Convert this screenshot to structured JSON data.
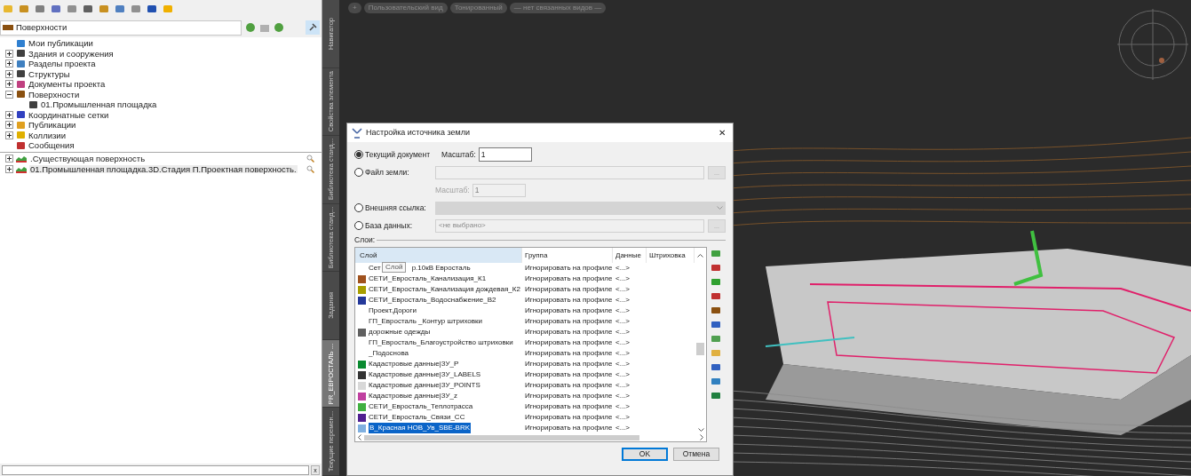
{
  "navigator": {
    "location": {
      "value": "Поверхности"
    },
    "tree": [
      {
        "label": "Мои публикации",
        "expandable": false
      },
      {
        "label": "Здания и сооружения",
        "expandable": true,
        "expanded": false
      },
      {
        "label": "Разделы проекта",
        "expandable": true,
        "expanded": false
      },
      {
        "label": "Структуры",
        "expandable": true,
        "expanded": false
      },
      {
        "label": "Документы проекта",
        "expandable": true,
        "expanded": false
      },
      {
        "label": "Поверхности",
        "expandable": true,
        "expanded": true,
        "children": [
          {
            "label": "01.Промышленная площадка",
            "expandable": false
          }
        ]
      },
      {
        "label": "Координатные сетки",
        "expandable": true,
        "expanded": false
      },
      {
        "label": "Публикации",
        "expandable": true,
        "expanded": false
      },
      {
        "label": "Коллизии",
        "expandable": true,
        "expanded": false
      },
      {
        "label": "Сообщения",
        "expandable": false
      }
    ],
    "surfaces": [
      {
        "label": ".Существующая поверхность",
        "selected": false
      },
      {
        "label": "01.Промышленная площадка.3D.Стадия П.Проектная поверхность.",
        "selected": true
      }
    ],
    "filter": {
      "clear": "x"
    }
  },
  "side_tabs": [
    {
      "label": "Навигатор",
      "selected": false
    },
    {
      "label": "Свойства элемента",
      "selected": false
    },
    {
      "label": "Библиотека станд...",
      "selected": false
    },
    {
      "label": "Библиотека станд...",
      "selected": false
    },
    {
      "label": "Задания",
      "selected": false
    },
    {
      "label": "PR_ЕВРОСТАЛЬ ...",
      "selected": true
    },
    {
      "label": "Текущие перемен...",
      "selected": false
    }
  ],
  "viewport": {
    "chips": [
      "+",
      "Пользовательский вид",
      "Тонированный",
      "— нет связанных видов —"
    ]
  },
  "dialog": {
    "title": "Настройка источника земли",
    "close": "✕",
    "sources": [
      {
        "kind": "scale",
        "label": "Текущий документ",
        "selected": true,
        "scale_label": "Масштаб:",
        "scale": "1"
      },
      {
        "kind": "file",
        "label": "Файл земли:",
        "selected": false,
        "browse": "...",
        "scale_label": "Масштаб:",
        "scale": "1"
      },
      {
        "kind": "dropdown",
        "label": "Внешняя ссылка:",
        "selected": false
      },
      {
        "kind": "database",
        "label": "База данных:",
        "selected": false,
        "value": "<не выбрано>",
        "browse": "..."
      }
    ],
    "layers_label": "Слои:",
    "columns": [
      "Слой",
      "Группа",
      "Данные",
      "Штриховка"
    ],
    "tooltip": "Слой",
    "rows": [
      {
        "layer": "Сет",
        "layer_tail": "р.10кВ Евросталь",
        "group": "Игнорировать на профиле",
        "data": "<...>",
        "selected": false
      },
      {
        "color": "#a0521e",
        "layer": "СЕТИ_Евросталь_Канализация_К1",
        "group": "Игнорировать на профиле",
        "data": "<...>",
        "selected": false
      },
      {
        "color": "#a89e00",
        "layer": "СЕТИ_Евросталь_Канализация дождевая_К2",
        "group": "Игнорировать на профиле",
        "data": "<...>",
        "selected": false
      },
      {
        "color": "#24389a",
        "layer": "СЕТИ_Евросталь_Водоснабжение_В2",
        "group": "Игнорировать на профиле",
        "data": "<...>",
        "selected": false
      },
      {
        "layer": "Проект.Дороги",
        "group": "Игнорировать на профиле",
        "data": "<...>",
        "selected": false
      },
      {
        "layer": "ГП_Евросталь _Контур штриховки",
        "group": "Игнорировать на профиле",
        "data": "<...>",
        "selected": false
      },
      {
        "color": "#606060",
        "layer": "дорожные одежды",
        "group": "Игнорировать на профиле",
        "data": "<...>",
        "selected": false
      },
      {
        "layer": "ГП_Евросталь_Благоустройство штриховки",
        "group": "Игнорировать на профиле",
        "data": "<...>",
        "selected": false
      },
      {
        "layer": "_Подоснова",
        "group": "Игнорировать на профиле",
        "data": "<...>",
        "selected": false
      },
      {
        "color": "#0a8a30",
        "layer": "Кадастровые данные|ЗУ_Р",
        "group": "Игнорировать на профиле",
        "data": "<...>",
        "selected": false
      },
      {
        "color": "#333333",
        "layer": "Кадастровые данные|ЗУ_LABELS",
        "group": "Игнорировать на профиле",
        "data": "<...>",
        "selected": false
      },
      {
        "color": "#d8d8d8",
        "layer": "Кадастровые данные|ЗУ_POINTS",
        "group": "Игнорировать на профиле",
        "data": "<...>",
        "selected": false
      },
      {
        "color": "#c040a0",
        "layer": "Кадастровые данные|ЗУ_z",
        "group": "Игнорировать на профиле",
        "data": "<...>",
        "selected": false
      },
      {
        "color": "#40b040",
        "layer": "СЕТИ_Евросталь_Теплотрасса",
        "group": "Игнорировать на профиле",
        "data": "<...>",
        "selected": false
      },
      {
        "color": "#502090",
        "layer": "СЕТИ_Евросталь_Связи_СС",
        "group": "Игнорировать на профиле",
        "data": "<...>",
        "selected": false
      },
      {
        "color": "#80b0e0",
        "layer": "В_Красная НОВ_Ув_SBE-BRK",
        "group": "Игнорировать на профиле",
        "data": "<...>",
        "selected": true
      }
    ],
    "buttons": [
      {
        "label": "OK",
        "default": true
      },
      {
        "label": "Отмена",
        "default": false
      }
    ]
  }
}
